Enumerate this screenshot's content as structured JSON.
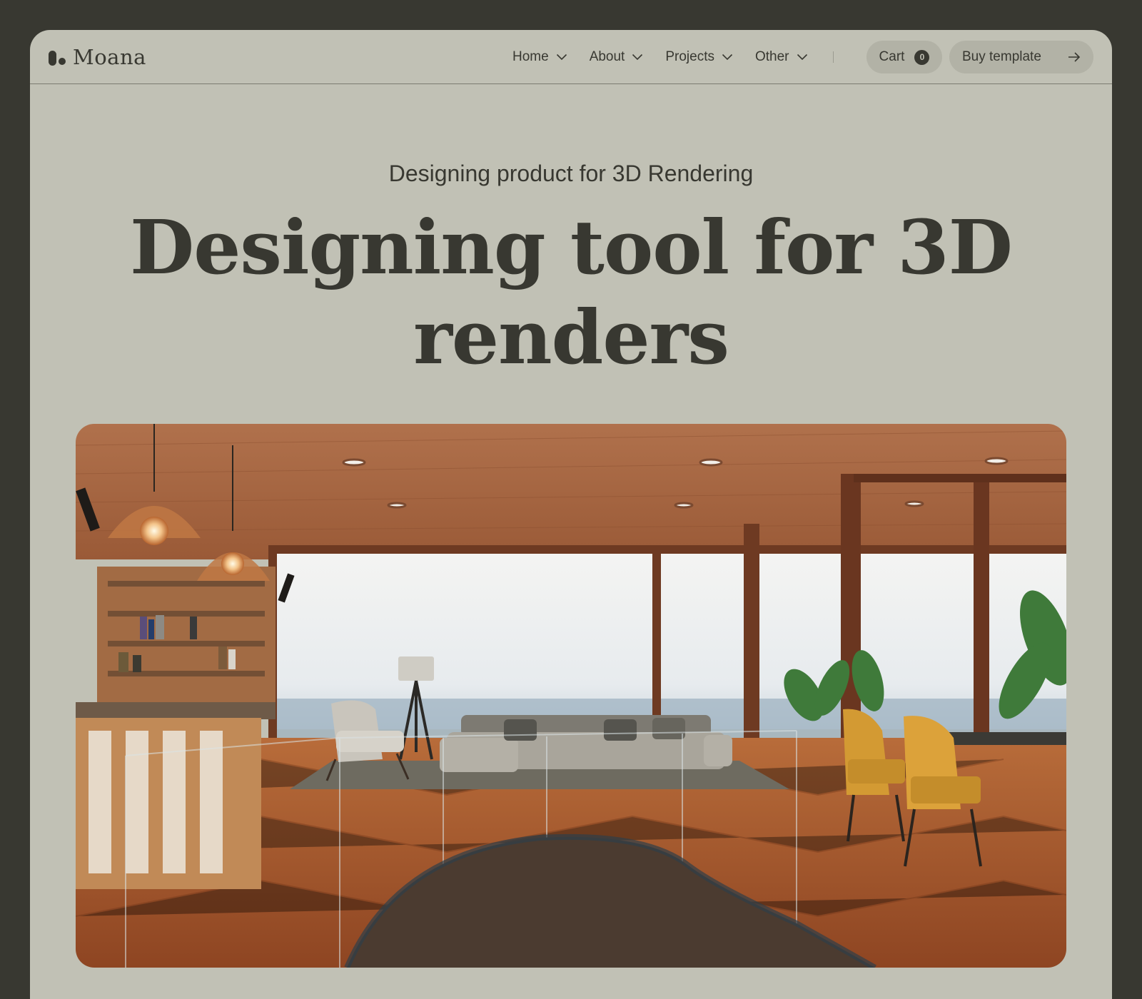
{
  "brand": {
    "name": "Moana"
  },
  "nav": {
    "items": [
      {
        "label": "Home"
      },
      {
        "label": "About"
      },
      {
        "label": "Projects"
      },
      {
        "label": "Other"
      }
    ],
    "cart": {
      "label": "Cart",
      "count": "0"
    },
    "buy": {
      "label": "Buy template"
    }
  },
  "hero": {
    "subtitle": "Designing product for 3D Rendering",
    "title_line1": "Designing tool for 3D",
    "title_line2": "renders",
    "image_alt": "3D rendered modern living room interior with wooden ceiling, sofa and ocean view"
  },
  "icons": {
    "chevron": "chevron-down-icon",
    "arrow": "arrow-right-icon"
  },
  "colors": {
    "background_dark": "#383831",
    "page_bg": "#c1c1b5",
    "button_bg": "#b2b2a6",
    "text": "#383831"
  }
}
